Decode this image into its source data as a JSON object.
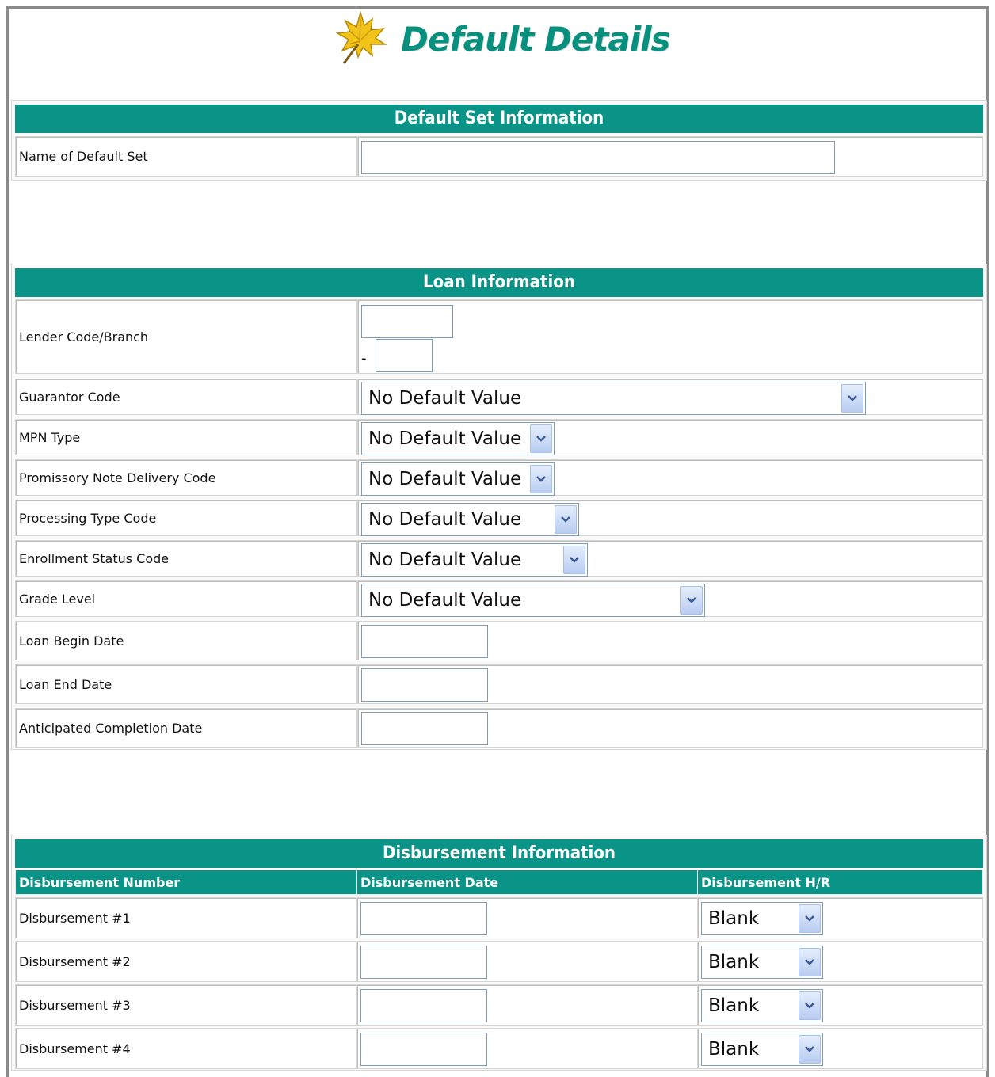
{
  "page": {
    "title": "Default Details",
    "logo_icon": "maple-leaf-icon",
    "accent_color": "#0a9488",
    "title_color": "#08907f"
  },
  "default_set": {
    "header": "Default Set Information",
    "name_label": "Name of Default Set",
    "name_value": ""
  },
  "loan": {
    "header": "Loan Information",
    "lender_label": "Lender Code/Branch",
    "lender_code": "",
    "branch_separator": "-",
    "branch": "",
    "guarantor_label": "Guarantor Code",
    "guarantor_value": "No Default Value",
    "mpn_label": "MPN Type",
    "mpn_value": "No Default Value",
    "pndc_label": "Promissory Note Delivery Code",
    "pndc_value": "No Default Value",
    "ptc_label": "Processing Type Code",
    "ptc_value": "No Default Value",
    "esc_label": "Enrollment Status Code",
    "esc_value": "No Default Value",
    "grade_label": "Grade Level",
    "grade_value": "No Default Value",
    "begin_label": "Loan Begin Date",
    "begin_value": "",
    "end_label": "Loan End Date",
    "end_value": "",
    "completion_label": "Anticipated Completion Date",
    "completion_value": ""
  },
  "disbursement": {
    "header": "Disbursement Information",
    "col_number": "Disbursement Number",
    "col_date": "Disbursement Date",
    "col_hr": "Disbursement H/R",
    "rows": [
      {
        "label": "Disbursement #1",
        "date": "",
        "hr": "Blank"
      },
      {
        "label": "Disbursement #2",
        "date": "",
        "hr": "Blank"
      },
      {
        "label": "Disbursement #3",
        "date": "",
        "hr": "Blank"
      },
      {
        "label": "Disbursement #4",
        "date": "",
        "hr": "Blank"
      }
    ]
  }
}
